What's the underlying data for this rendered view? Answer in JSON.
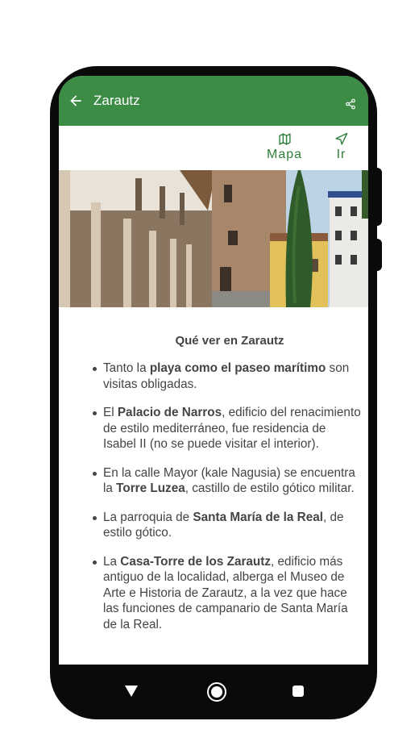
{
  "app_bar": {
    "title": "Zarautz",
    "back_icon": "arrow-left-icon",
    "share_icon": "share-icon",
    "color": "#3d8c46"
  },
  "actions": {
    "map_label": "Mapa",
    "go_label": "Ir",
    "map_icon": "map-icon",
    "go_icon": "navigation-icon",
    "color": "#2e7d3a"
  },
  "content": {
    "heading": "Qué ver en Zarautz",
    "items": [
      [
        {
          "t": "Tanto la ",
          "b": false
        },
        {
          "t": "playa como el paseo marítimo",
          "b": true
        },
        {
          "t": " son visitas obligadas.",
          "b": false
        }
      ],
      [
        {
          "t": "El ",
          "b": false
        },
        {
          "t": "Palacio de Narros",
          "b": true
        },
        {
          "t": ", edificio del renacimiento de estilo mediterráneo, fue residencia de Isabel II (no se puede visitar el interior).",
          "b": false
        }
      ],
      [
        {
          "t": "En la calle Mayor (kale Nagusia) se encuentra la ",
          "b": false
        },
        {
          "t": "Torre Luzea",
          "b": true
        },
        {
          "t": ", castillo de estilo gótico militar.",
          "b": false
        }
      ],
      [
        {
          "t": "La parroquia de ",
          "b": false
        },
        {
          "t": "Santa María de la Real",
          "b": true
        },
        {
          "t": ", de estilo gótico.",
          "b": false
        }
      ],
      [
        {
          "t": "La ",
          "b": false
        },
        {
          "t": "Casa-Torre de los Zarautz",
          "b": true
        },
        {
          "t": ", edificio más antiguo de la localidad, alberga el Museo de Arte e Historia de Zarautz, a la vez que hace las funciones de campanario de Santa María de la Real.",
          "b": false
        }
      ]
    ]
  },
  "nav_bar": {
    "back_icon": "nav-back-triangle-icon",
    "home_icon": "nav-home-circle-icon",
    "recents_icon": "nav-recents-square-icon"
  }
}
